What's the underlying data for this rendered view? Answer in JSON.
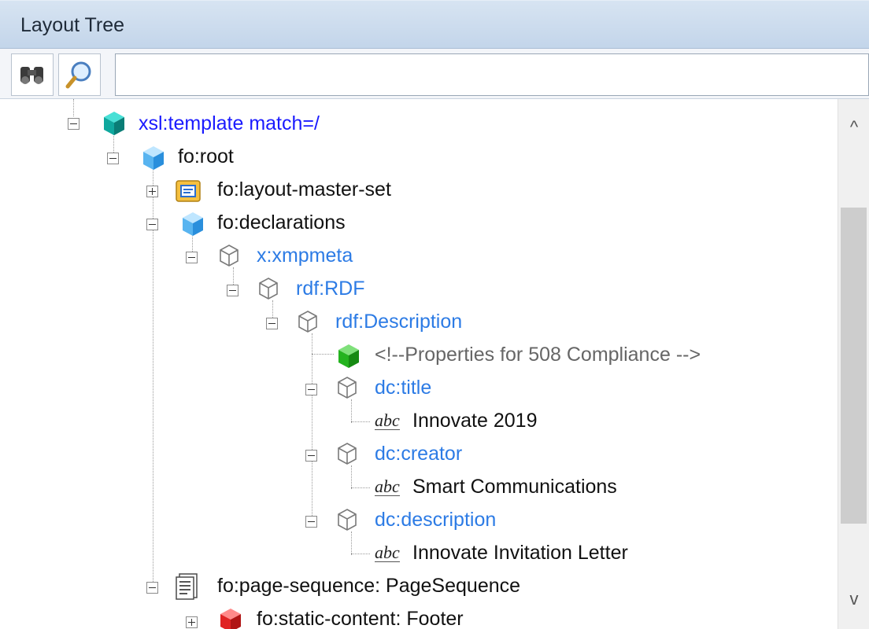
{
  "panel": {
    "title": "Layout Tree"
  },
  "toolbar": {
    "find_icon": "binoculars-icon",
    "search_icon": "magnifier-icon",
    "search_value": "",
    "search_placeholder": ""
  },
  "tree": {
    "nodes": [
      {
        "label": "xsl:template match=/",
        "icon": "teal-cube-icon",
        "expanded": true
      },
      {
        "label": "fo:root",
        "icon": "blue-cube-icon",
        "expanded": true
      },
      {
        "label": "fo:layout-master-set",
        "icon": "layout-master-icon",
        "expanded": false
      },
      {
        "label": "fo:declarations",
        "icon": "blue-cube-icon",
        "expanded": true
      },
      {
        "label": "x:xmpmeta",
        "icon": "outline-cube-icon",
        "expanded": true
      },
      {
        "label": "rdf:RDF",
        "icon": "outline-cube-icon",
        "expanded": true
      },
      {
        "label": "rdf:Description",
        "icon": "outline-cube-icon",
        "expanded": true
      },
      {
        "label": "<!--Properties for 508 Compliance -->",
        "icon": "green-cube-icon"
      },
      {
        "label": "dc:title",
        "icon": "outline-cube-icon",
        "expanded": true
      },
      {
        "label": "Innovate 2019",
        "icon": "abc-text-icon"
      },
      {
        "label": "dc:creator",
        "icon": "outline-cube-icon",
        "expanded": true
      },
      {
        "label": "Smart Communications",
        "icon": "abc-text-icon"
      },
      {
        "label": "dc:description",
        "icon": "outline-cube-icon",
        "expanded": true
      },
      {
        "label": "Innovate Invitation Letter",
        "icon": "abc-text-icon"
      },
      {
        "label": "fo:page-sequence: PageSequence",
        "icon": "page-sequence-icon",
        "expanded": true
      },
      {
        "label": "fo:static-content: Footer",
        "icon": "red-cube-icon",
        "expanded": false
      }
    ],
    "abc_glyph": "abc"
  },
  "scrollbar": {
    "up": "^",
    "down": "v"
  },
  "colors": {
    "keyword": "#1a1aff",
    "element": "#111111",
    "namespace": "#2c7be5",
    "comment": "#666666",
    "titlebar": "#c9d9eb"
  }
}
